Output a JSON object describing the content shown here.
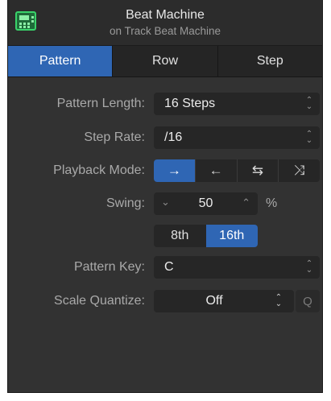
{
  "header": {
    "title": "Beat Machine",
    "subtitle": "on Track Beat Machine",
    "icon": "drum-machine-icon",
    "icon_color": "#39d36a"
  },
  "tabs": [
    {
      "label": "Pattern",
      "active": true
    },
    {
      "label": "Row",
      "active": false
    },
    {
      "label": "Step",
      "active": false
    }
  ],
  "accent": "#2f66b4",
  "fields": {
    "pattern_length": {
      "label": "Pattern Length:",
      "value": "16 Steps"
    },
    "step_rate": {
      "label": "Step Rate:",
      "value": "/16"
    },
    "playback_mode": {
      "label": "Playback Mode:",
      "options": [
        {
          "glyph": "→",
          "name": "forward",
          "active": true
        },
        {
          "glyph": "←",
          "name": "reverse",
          "active": false
        },
        {
          "glyph": "⇆",
          "name": "ping-pong",
          "active": false
        },
        {
          "glyph": "⤨",
          "name": "random",
          "active": false
        }
      ]
    },
    "swing": {
      "label": "Swing:",
      "value": "50",
      "unit": "%",
      "dec": "⌄",
      "inc": "⌃"
    },
    "swing_note": {
      "options": [
        {
          "label": "8th",
          "active": false
        },
        {
          "label": "16th",
          "active": true
        }
      ]
    },
    "pattern_key": {
      "label": "Pattern Key:",
      "value": "C"
    },
    "scale_quantize": {
      "label": "Scale Quantize:",
      "value": "Off",
      "q_label": "Q"
    }
  },
  "updown_glyph": "⌃⌄"
}
